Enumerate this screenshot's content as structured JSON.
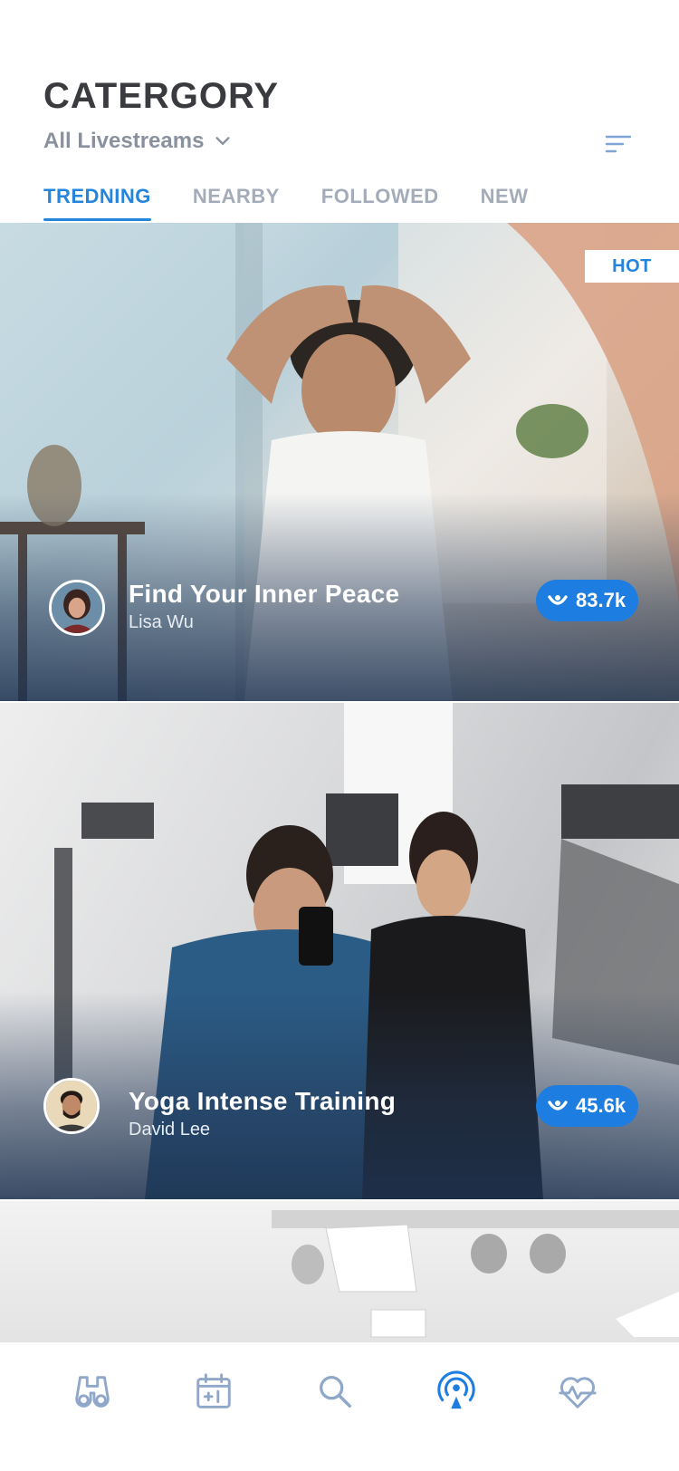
{
  "header": {
    "title": "CATERGORY",
    "filter_label": "All Livestreams",
    "filter_icon": "chevron-down-icon",
    "sort_icon": "sort-lines-icon"
  },
  "tabs": [
    {
      "label": "TREDNING",
      "active": true
    },
    {
      "label": "NEARBY",
      "active": false
    },
    {
      "label": "FOLLOWED",
      "active": false
    },
    {
      "label": "NEW",
      "active": false
    }
  ],
  "streams": [
    {
      "title": "Find Your Inner Peace",
      "host": "Lisa Wu",
      "viewers": "83.7k",
      "badge": "HOT"
    },
    {
      "title": "Yoga Intense Training",
      "host": "David Lee",
      "viewers": "45.6k"
    }
  ],
  "bottom_nav": [
    {
      "icon": "binoculars-icon",
      "active": false
    },
    {
      "icon": "calendar-plus-icon",
      "active": false
    },
    {
      "icon": "search-icon",
      "active": false
    },
    {
      "icon": "livestream-icon",
      "active": true
    },
    {
      "icon": "heart-pulse-icon",
      "active": false
    }
  ],
  "colors": {
    "accent": "#2584dc",
    "title_text": "#3a3b3f",
    "inactive_tab": "#a4acb9",
    "nav_icon": "#8fa7c9",
    "viewer_pill": "#1d7de0"
  }
}
